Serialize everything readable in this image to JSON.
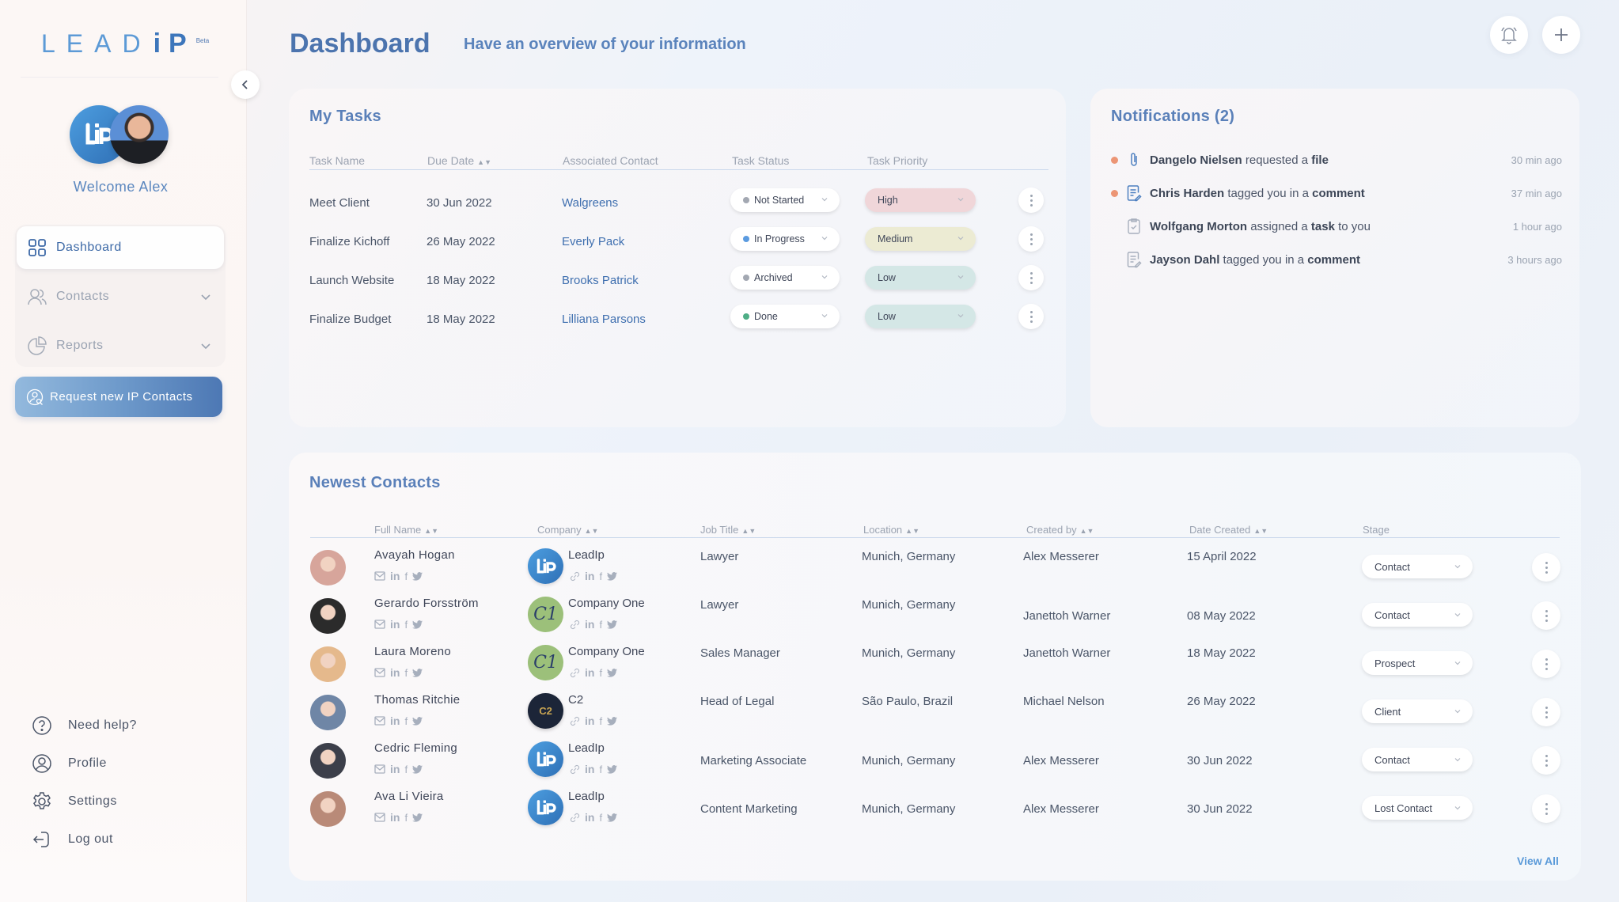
{
  "app": {
    "logo_text": "LEAD",
    "logo_ip": "iP",
    "logo_badge": "Beta",
    "welcome": "Welcome Alex"
  },
  "sidebar": {
    "nav": [
      {
        "label": "Dashboard",
        "icon": "grid-icon",
        "active": true
      },
      {
        "label": "Contacts",
        "icon": "users-icon",
        "expandable": true
      },
      {
        "label": "Reports",
        "icon": "pie-chart-icon",
        "expandable": true
      }
    ],
    "request_button": "Request new IP Contacts",
    "bottom": [
      {
        "label": "Need help?",
        "icon": "help-icon"
      },
      {
        "label": "Profile",
        "icon": "profile-icon"
      },
      {
        "label": "Settings",
        "icon": "gear-icon"
      },
      {
        "label": "Log out",
        "icon": "logout-icon"
      }
    ]
  },
  "header": {
    "title": "Dashboard",
    "subtitle": "Have an overview of your information",
    "bell_icon": "bell-icon",
    "plus_icon": "plus-icon"
  },
  "tasks": {
    "title": "My Tasks",
    "columns": [
      "Task Name",
      "Due Date",
      "Associated Contact",
      "Task Status",
      "Task Priority"
    ],
    "rows": [
      {
        "name": "Meet Client",
        "due": "30 Jun 2022",
        "contact": "Walgreens",
        "status": "Not Started",
        "status_color": "#a3a8b2",
        "priority": "High",
        "priority_color": "#f0d6d9"
      },
      {
        "name": "Finalize Kichoff",
        "due": "26 May 2022",
        "contact": "Everly Pack",
        "status": "In Progress",
        "status_color": "#5b9be0",
        "priority": "Medium",
        "priority_color": "#ecebd3"
      },
      {
        "name": "Launch Website",
        "due": "18 May 2022",
        "contact": "Brooks Patrick",
        "status": "Archived",
        "status_color": "#a3a8b2",
        "priority": "Low",
        "priority_color": "#d4e7e6"
      },
      {
        "name": "Finalize Budget",
        "due": "18 May 2022",
        "contact": "Lilliana Parsons",
        "status": "Done",
        "status_color": "#4fae86",
        "priority": "Low",
        "priority_color": "#d4e7e6"
      }
    ]
  },
  "notifications": {
    "title": "Notifications (2)",
    "items": [
      {
        "actor": "Dangelo Nielsen",
        "action": " requested a ",
        "object": "file",
        "time": "30 min ago",
        "unread": true,
        "icon": "paperclip-icon"
      },
      {
        "actor": "Chris Harden",
        "action": " tagged you in a ",
        "object": "comment",
        "time": "37 min ago",
        "unread": true,
        "icon": "comment-doc-icon"
      },
      {
        "actor": "Wolfgang Morton",
        "action": " assigned a ",
        "object": "task",
        "suffix": " to you",
        "time": "1 hour ago",
        "unread": false,
        "icon": "clipboard-check-icon"
      },
      {
        "actor": "Jayson Dahl",
        "action": " tagged you in a ",
        "object": "comment",
        "time": "3 hours ago",
        "unread": false,
        "icon": "comment-doc-icon"
      }
    ]
  },
  "contacts": {
    "title": "Newest Contacts",
    "columns": [
      "Full Name",
      "Company",
      "Job Title",
      "Location",
      "Created by",
      "Date Created",
      "Stage"
    ],
    "rows": [
      {
        "name": "Avayah Hogan",
        "company": "LeadIp",
        "company_logo": "leadip",
        "job": "Lawyer",
        "location": "Munich, Germany",
        "created_by": "Alex Messerer",
        "date": "15 April 2022",
        "stage": "Contact",
        "avatar_color": "#d7a59b"
      },
      {
        "name": "Gerardo Forsström",
        "company": "Company One",
        "company_logo": "c1",
        "job": "Lawyer",
        "location": "Munich, Germany",
        "created_by": "Janettoh Warner",
        "date": "08 May 2022",
        "stage": "Contact",
        "avatar_color": "#2b2b2b"
      },
      {
        "name": "Laura Moreno",
        "company": "Company One",
        "company_logo": "c1",
        "job": "Sales Manager",
        "location": "Munich, Germany",
        "created_by": "Janettoh Warner",
        "date": "18 May 2022",
        "stage": "Prospect",
        "avatar_color": "#e5b98c"
      },
      {
        "name": "Thomas Ritchie",
        "company": "C2",
        "company_logo": "c2",
        "job": "Head of Legal",
        "location": "São Paulo, Brazil",
        "created_by": "Michael Nelson",
        "date": "26 May 2022",
        "stage": "Client",
        "avatar_color": "#6f86a6"
      },
      {
        "name": "Cedric Fleming",
        "company": "LeadIp",
        "company_logo": "leadip",
        "job": "Marketing Associate",
        "location": "Munich, Germany",
        "created_by": "Alex Messerer",
        "date": "30 Jun 2022",
        "stage": "Contact",
        "avatar_color": "#3c3f4a"
      },
      {
        "name": "Ava Li Vieira",
        "company": "LeadIp",
        "company_logo": "leadip",
        "job": "Content Marketing",
        "location": "Munich, Germany",
        "created_by": "Alex Messerer",
        "date": "30 Jun 2022",
        "stage": "Lost Contact",
        "avatar_color": "#b98a78"
      }
    ],
    "view_all": "View All"
  },
  "colors": {
    "accent": "#4c74ae",
    "link": "#3f6faf",
    "unread_dot": "#ec9575",
    "leadip_logo": "#3b82c9",
    "company_one_logo": "#9cc07a",
    "c2_logo": "#1c2538"
  }
}
